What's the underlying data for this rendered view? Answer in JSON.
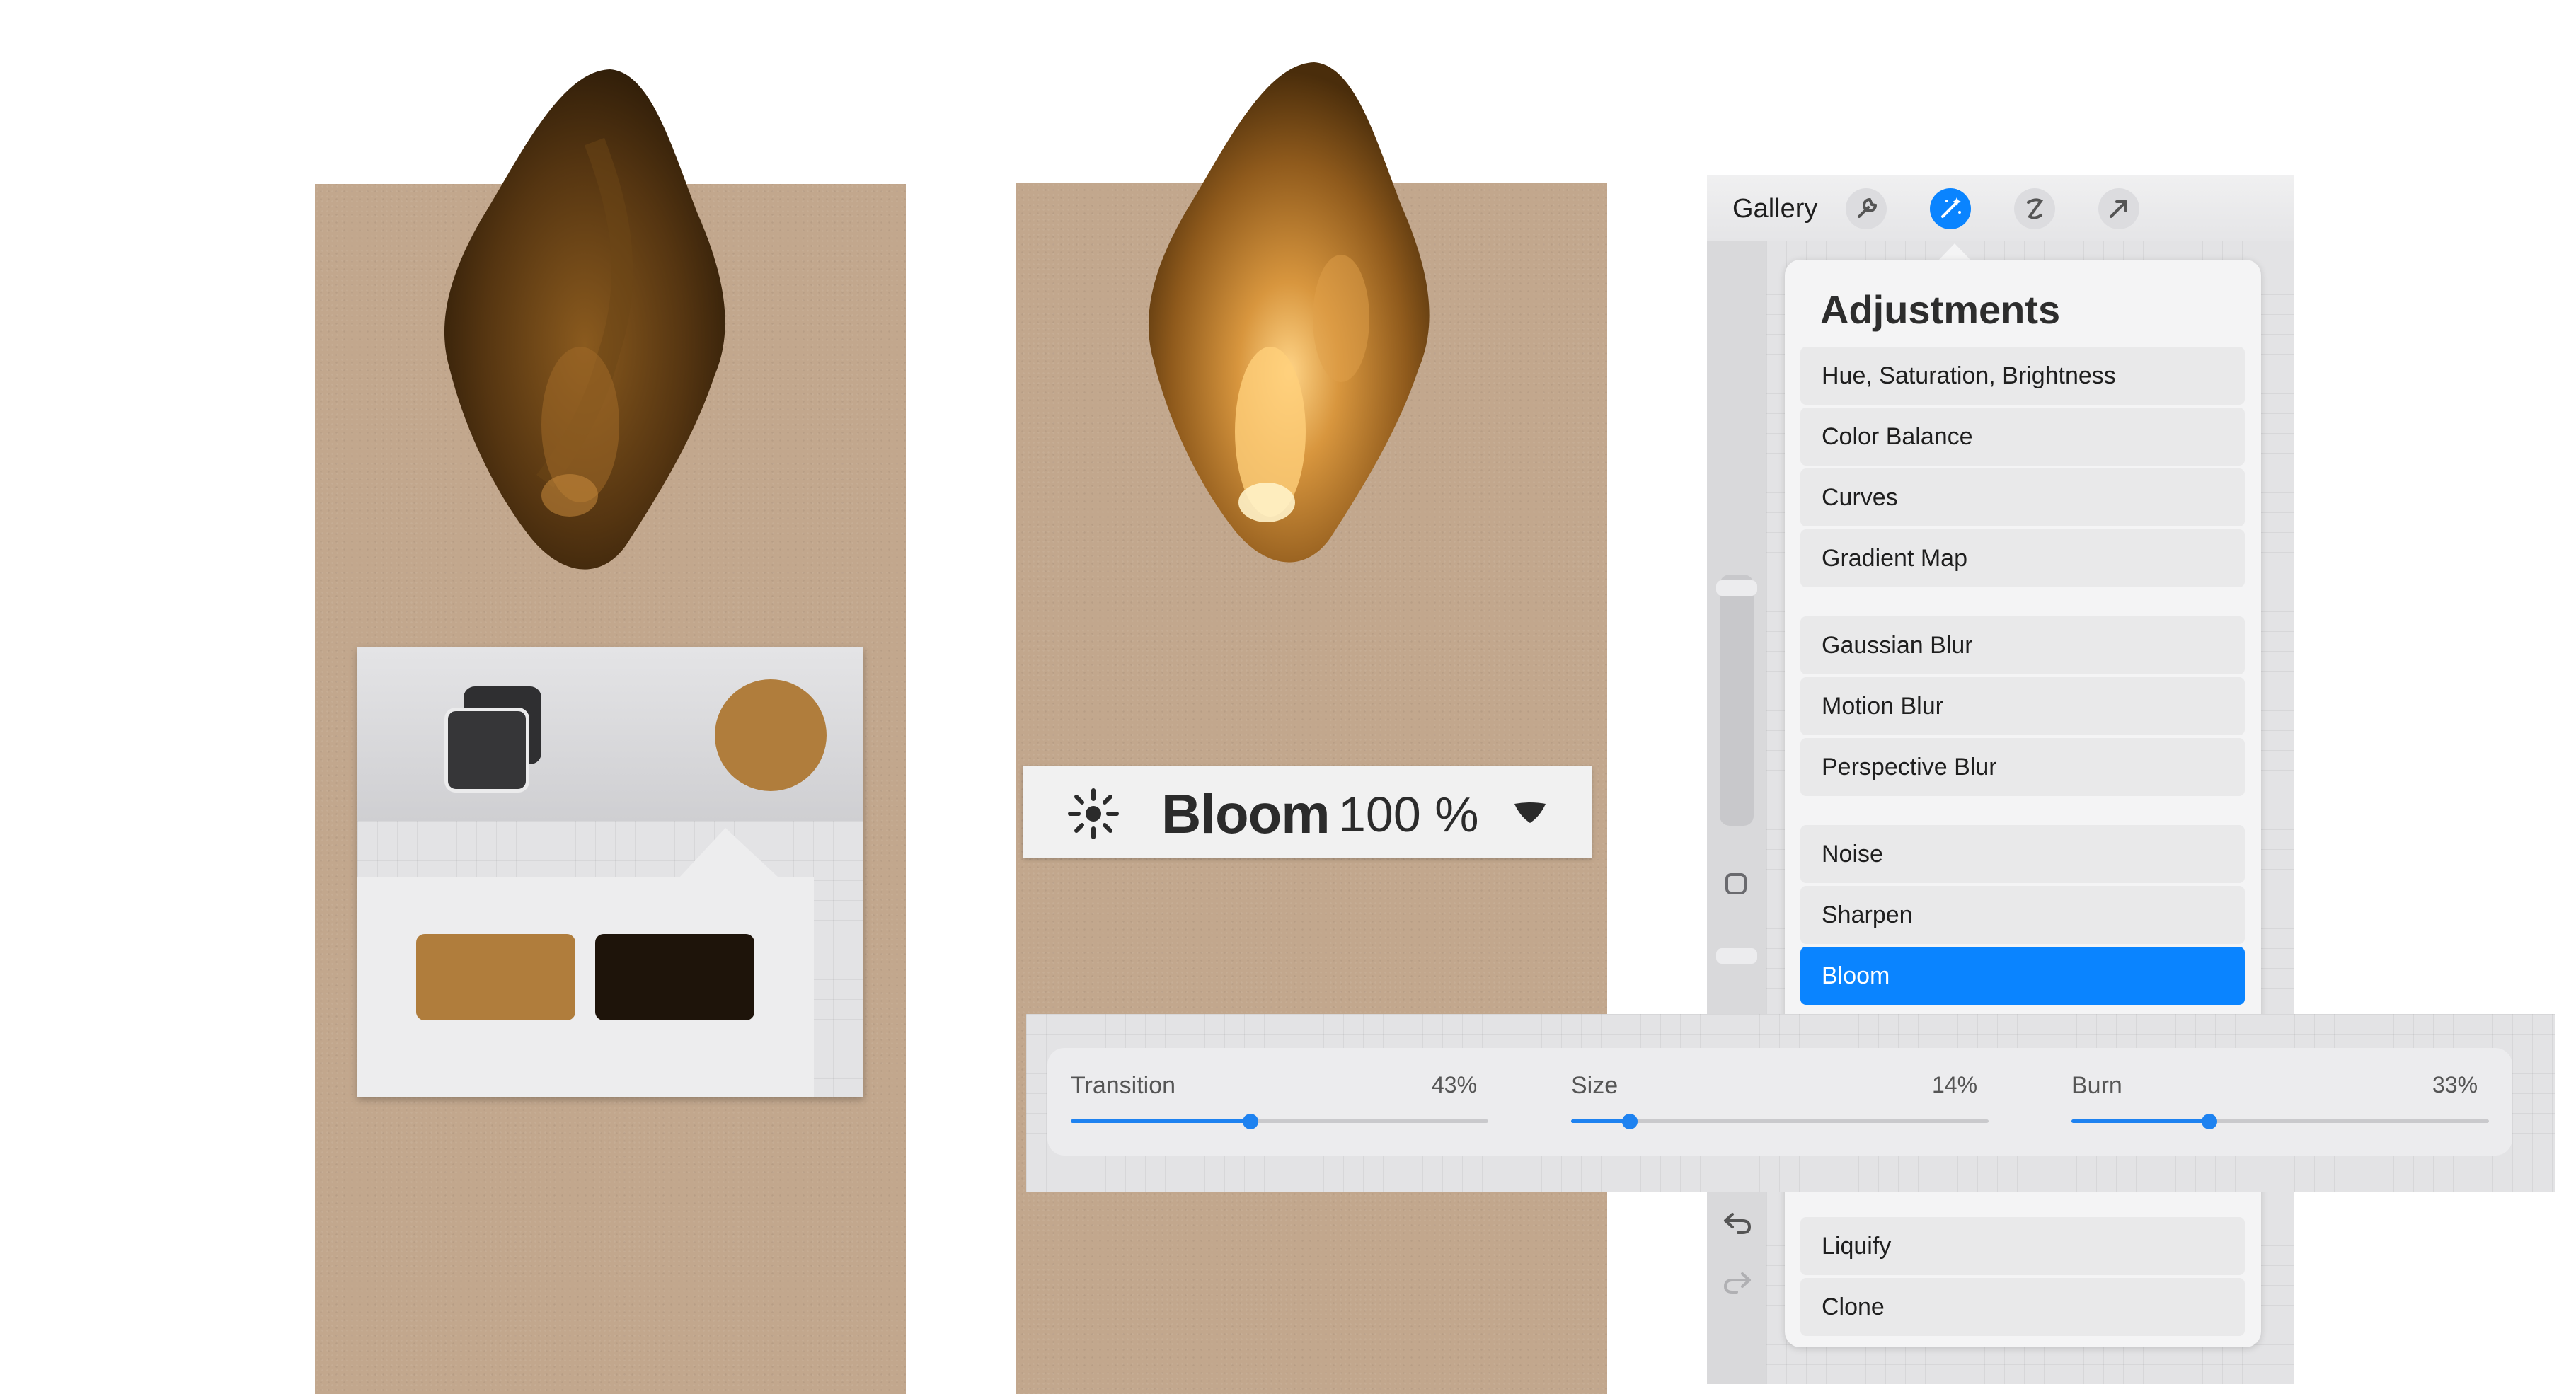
{
  "swatch_panel": {
    "swatch_colors": [
      "#b07d3c",
      "#1e140a"
    ],
    "current_color": "#b07d3c"
  },
  "layer_pill": {
    "name": "Bloom",
    "opacity": "100 %"
  },
  "toolbar": {
    "gallery_label": "Gallery",
    "active_tool": "adjustments-magic-wand"
  },
  "adjustments": {
    "title": "Adjustments",
    "group1": [
      "Hue, Saturation, Brightness",
      "Color Balance",
      "Curves",
      "Gradient Map"
    ],
    "group2": [
      "Gaussian Blur",
      "Motion Blur",
      "Perspective Blur"
    ],
    "group3": [
      "Noise",
      "Sharpen",
      "Bloom"
    ],
    "group4": [
      "Liquify",
      "Clone"
    ],
    "selected": "Bloom",
    "accent": "#0a84ff"
  },
  "bloom_settings": [
    {
      "label": "Transition",
      "percent": "43%",
      "value": 0.43
    },
    {
      "label": "Size",
      "percent": "14%",
      "value": 0.14
    },
    {
      "label": "Burn",
      "percent": "33%",
      "value": 0.33
    }
  ]
}
